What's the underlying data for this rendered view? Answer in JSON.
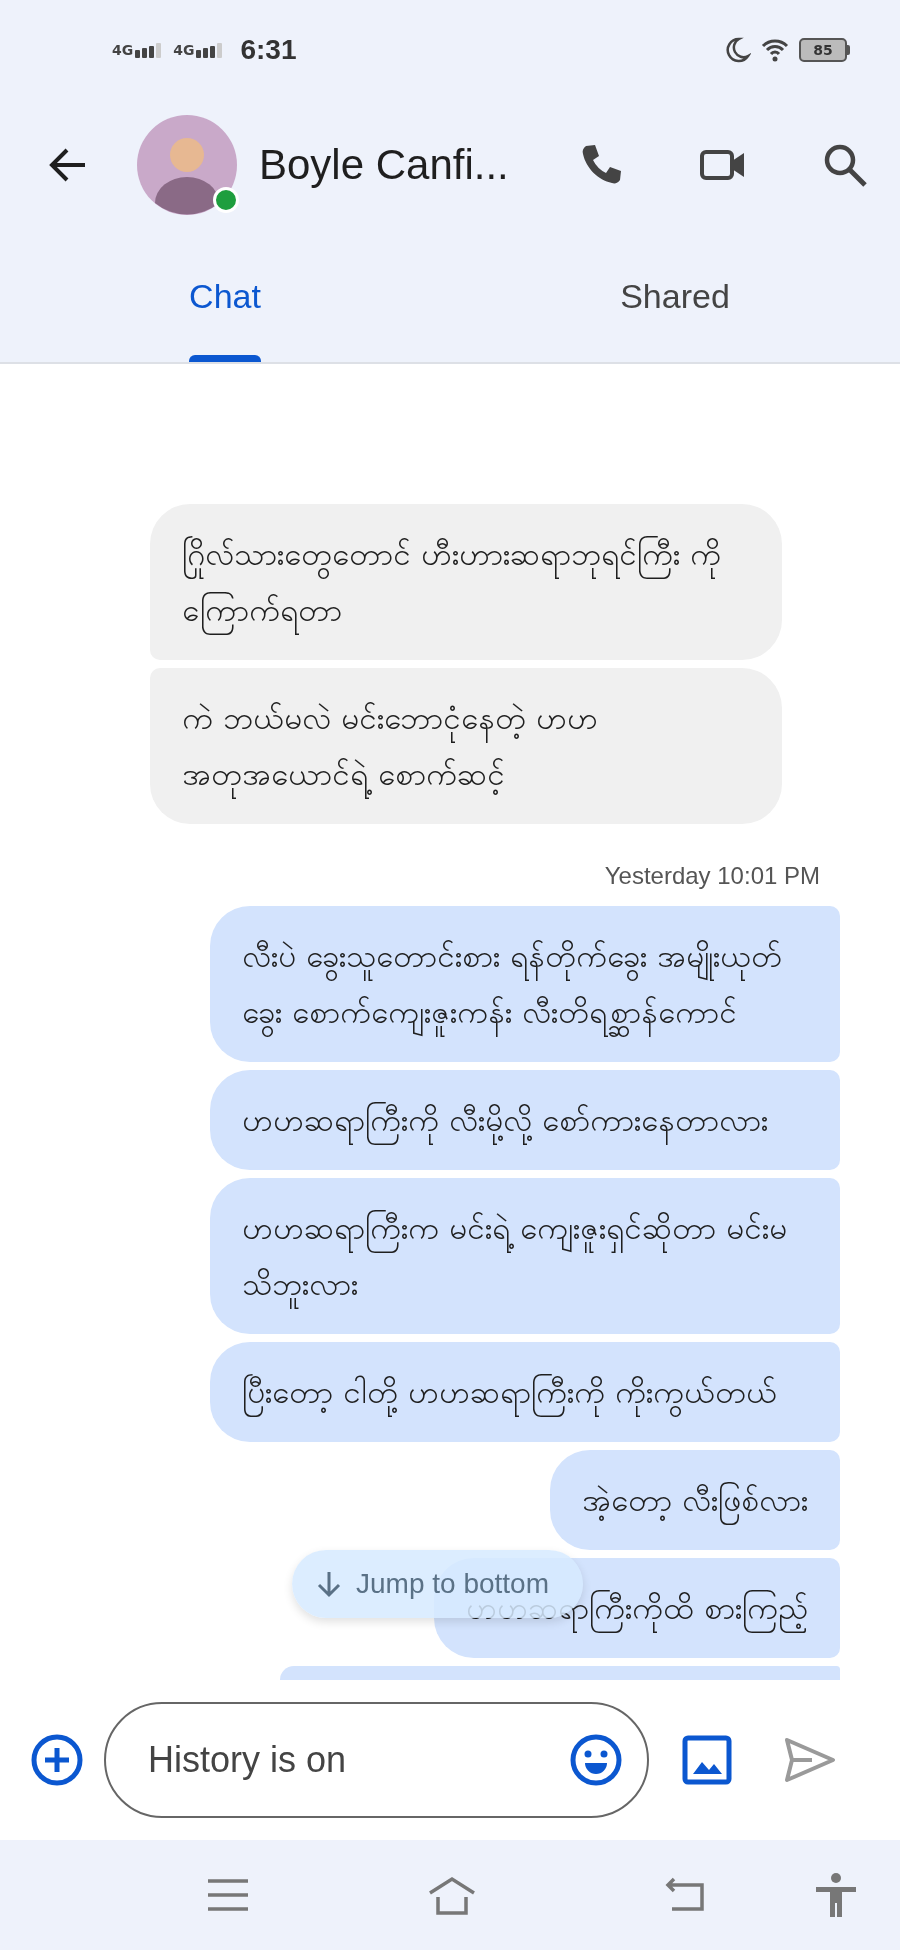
{
  "status_bar": {
    "networks": [
      "4G",
      "4G"
    ],
    "time": "6:31",
    "battery": "85"
  },
  "header": {
    "contact_name": "Boyle Canfi...",
    "online": true
  },
  "tabs": [
    {
      "label": "Chat",
      "selected": true
    },
    {
      "label": "Shared",
      "selected": false
    }
  ],
  "messages": [
    {
      "kind": "received",
      "text": "ဂြိုလ်သားတွေတောင် ဟီးဟားဆရာဘုရင်ကြီး ကို ကြောက်ရတာ"
    },
    {
      "kind": "received",
      "text": "ကဲ ဘယ်မလဲ မင်းဘောငုံနေတဲ့ ဟဟ အတုအယောင်ရဲ့ စောက်ဆင့်"
    },
    {
      "kind": "timestamp",
      "text": "Yesterday 10:01 PM"
    },
    {
      "kind": "sent",
      "text": "လီးပဲ ခွေးသူတောင်းစား ရန်တိုက်ခွေး အမျိုးယုတ်ခွေး စောက်ကျေးဇူးကန်း လီးတိရစ္ဆာန်ကောင်"
    },
    {
      "kind": "sent",
      "text": "ဟဟဆရာကြီးကို လီးမို့လို့ စော်ကားနေတာလား"
    },
    {
      "kind": "sent",
      "text": "ဟဟဆရာကြီးက မင်းရဲ့ ကျေးဇူးရှင်ဆိုတာ မင်းမသိဘူးလား"
    },
    {
      "kind": "sent",
      "text": "ပြီးတော့ ငါတို့ ဟဟဆရာကြီးကို ကိုးကွယ်တယ်"
    },
    {
      "kind": "sent",
      "text": "အဲ့တော့ လီးဖြစ်လား"
    },
    {
      "kind": "sent",
      "text": "ဟဟဆရာကြီးကိုထိ စားကြည့်"
    },
    {
      "kind": "sent_partial"
    }
  ],
  "jump_button": {
    "label": "Jump to bottom"
  },
  "composer": {
    "placeholder": "History is on"
  }
}
